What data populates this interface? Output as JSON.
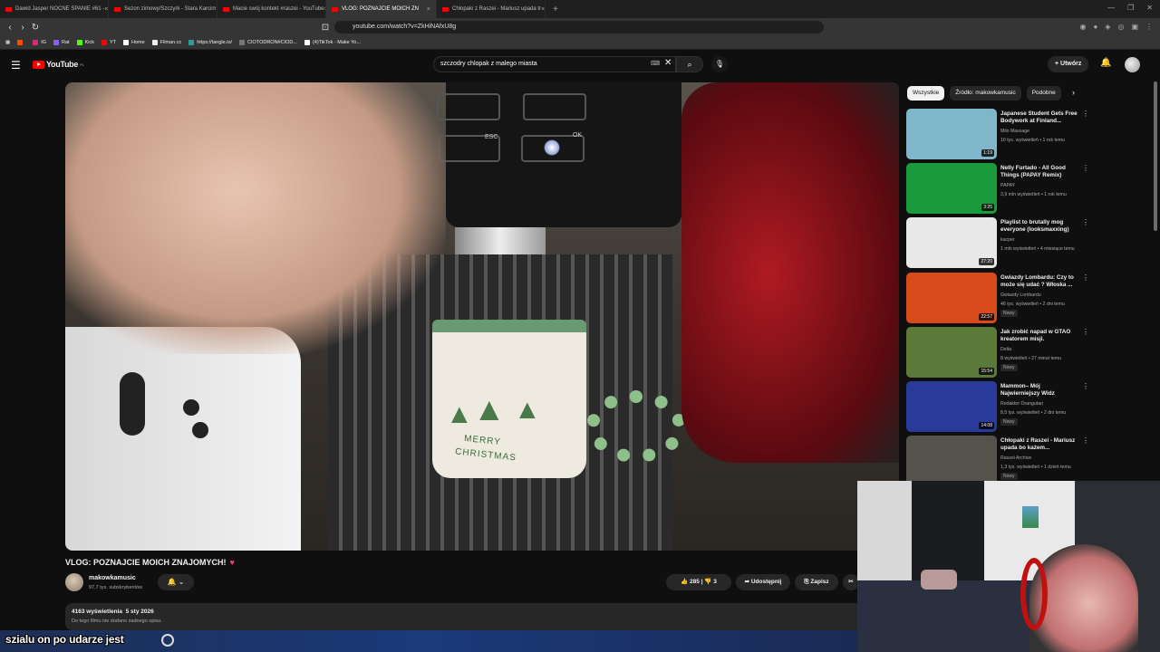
{
  "browser": {
    "tabs": [
      {
        "label": "Dawid Jasper NOCNE SPANIE #61 -",
        "active": false
      },
      {
        "label": "Sezon zimowy/Szczyrk - Stara Karcim",
        "active": false
      },
      {
        "label": "Macie swój kontekt #raszei - YouTube",
        "active": false
      },
      {
        "label": "VLOG: POZNAJCIE MOICH ZN",
        "active": true
      },
      {
        "label": "Chłopaki z Raszei - Mariusz upada tr",
        "active": false
      }
    ],
    "new_tab": "+",
    "url": "youtube.com/watch?v=ZkHiNAfxU8g",
    "bookmarks": [
      {
        "label": "",
        "color": "#ff4a00"
      },
      {
        "label": "IG",
        "color": "#d62976"
      },
      {
        "label": "Rat",
        "color": "#8b5cf6"
      },
      {
        "label": "Kick",
        "color": "#53fc18"
      },
      {
        "label": "YT",
        "color": "#ff0000"
      },
      {
        "label": "Home",
        "color": "#ffffff"
      },
      {
        "label": "Filman.cc",
        "color": "#eeeeee"
      },
      {
        "label": "https://tangle.io/",
        "color": "#2aa198"
      },
      {
        "label": "CIOTODRON#CIOD...",
        "color": "#777777"
      },
      {
        "label": "(4)TikTok - Make Yo...",
        "color": "#ffffff"
      }
    ]
  },
  "youtube": {
    "logo": "YouTube",
    "logo_region": "PL",
    "search_value": "szczodry chlopak z malego miasta",
    "create_label": "Utwórz",
    "video": {
      "title": "VLOG: POZNAJCIE MOICH ZNAJOMYCH!",
      "heart": "♥",
      "channel": "makowkamusic",
      "subscribers": "97,7 tys. subskrybentów",
      "likes": "285",
      "dislikes": "3",
      "share_label": "Udostępnij",
      "save_label": "Zapisz",
      "views": "4163 wyświetlenia",
      "date": "5 sty 2026",
      "description": "Do tego filmu nie dodano żadnego opisu.",
      "mug_text_1": "MERRY",
      "mug_text_2": "CHRISTMAS",
      "esc_label": "ESC",
      "ok_label": "OK"
    },
    "chips": [
      "Wszystkie",
      "Źródło: makowkamusic",
      "Podobne"
    ],
    "recommendations": [
      {
        "title": "Japanese Student Gets Free Bodywork at Finland...",
        "channel": "Milo Massage",
        "meta": "10 tys. wyświetleń • 1 rok temu",
        "duration": "1:19",
        "badge": "",
        "thumb": "#7fb6c9"
      },
      {
        "title": "Nelly Furtado - All Good Things (PAPAY Remix)",
        "channel": "PAPAY",
        "meta": "3,9 mln wyświetleń • 1 rok temu",
        "duration": "3:25",
        "badge": "",
        "thumb": "#1a9a3a"
      },
      {
        "title": "Playlist to brutally mog everyone (looksmaxxing)",
        "channel": "kacper",
        "meta": "1 mln wyświetleń • 4 miesiące temu",
        "duration": "27:20",
        "badge": "",
        "thumb": "#e8e8e8"
      },
      {
        "title": "Gwiazdy Lombardu: Czy to może się udać ? Włoska ...",
        "channel": "Gwiazdy Lombardu",
        "meta": "46 tys. wyświetleń • 2 dni temu",
        "duration": "22:57",
        "badge": "Nowy",
        "thumb": "#d94a1a"
      },
      {
        "title": "Jak zrobić napad w GTAO kreatorem misji.",
        "channel": "Delta",
        "meta": "8 wyświetleń • 27 minut temu",
        "duration": "15:54",
        "badge": "Nowy",
        "thumb": "#5b7a3a"
      },
      {
        "title": "Mammon– Mój Najwierniejszy Widz",
        "channel": "Redaktor Orangutan",
        "meta": "8,5 tys. wyświetleń • 2 dni temu",
        "duration": "14:08",
        "badge": "Nowy",
        "thumb": "#2a3a9a"
      },
      {
        "title": "Chłopaki z Raszei - Mariusz upada bo każem...",
        "channel": "Raszei Archive",
        "meta": "1,3 tys. wyświetleń • 1 dzień temu",
        "duration": "",
        "badge": "Nowy",
        "thumb": "#55524c"
      }
    ]
  },
  "overlay": {
    "text": "szialu on po udarze jest"
  }
}
